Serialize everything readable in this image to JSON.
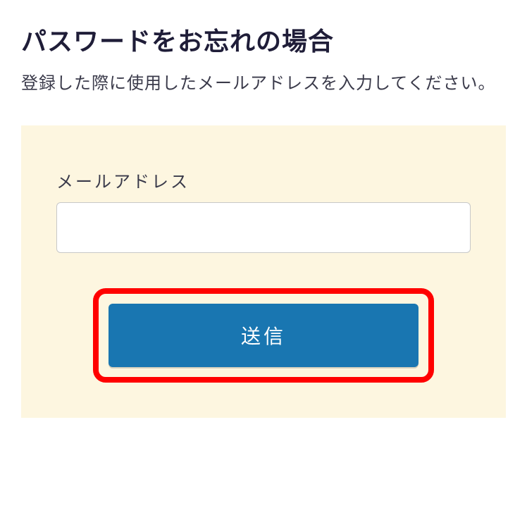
{
  "header": {
    "title": "パスワードをお忘れの場合",
    "description": "登録した際に使用したメールアドレスを入力してください。"
  },
  "form": {
    "email_label": "メールアドレス",
    "email_value": "",
    "submit_label": "送信"
  }
}
